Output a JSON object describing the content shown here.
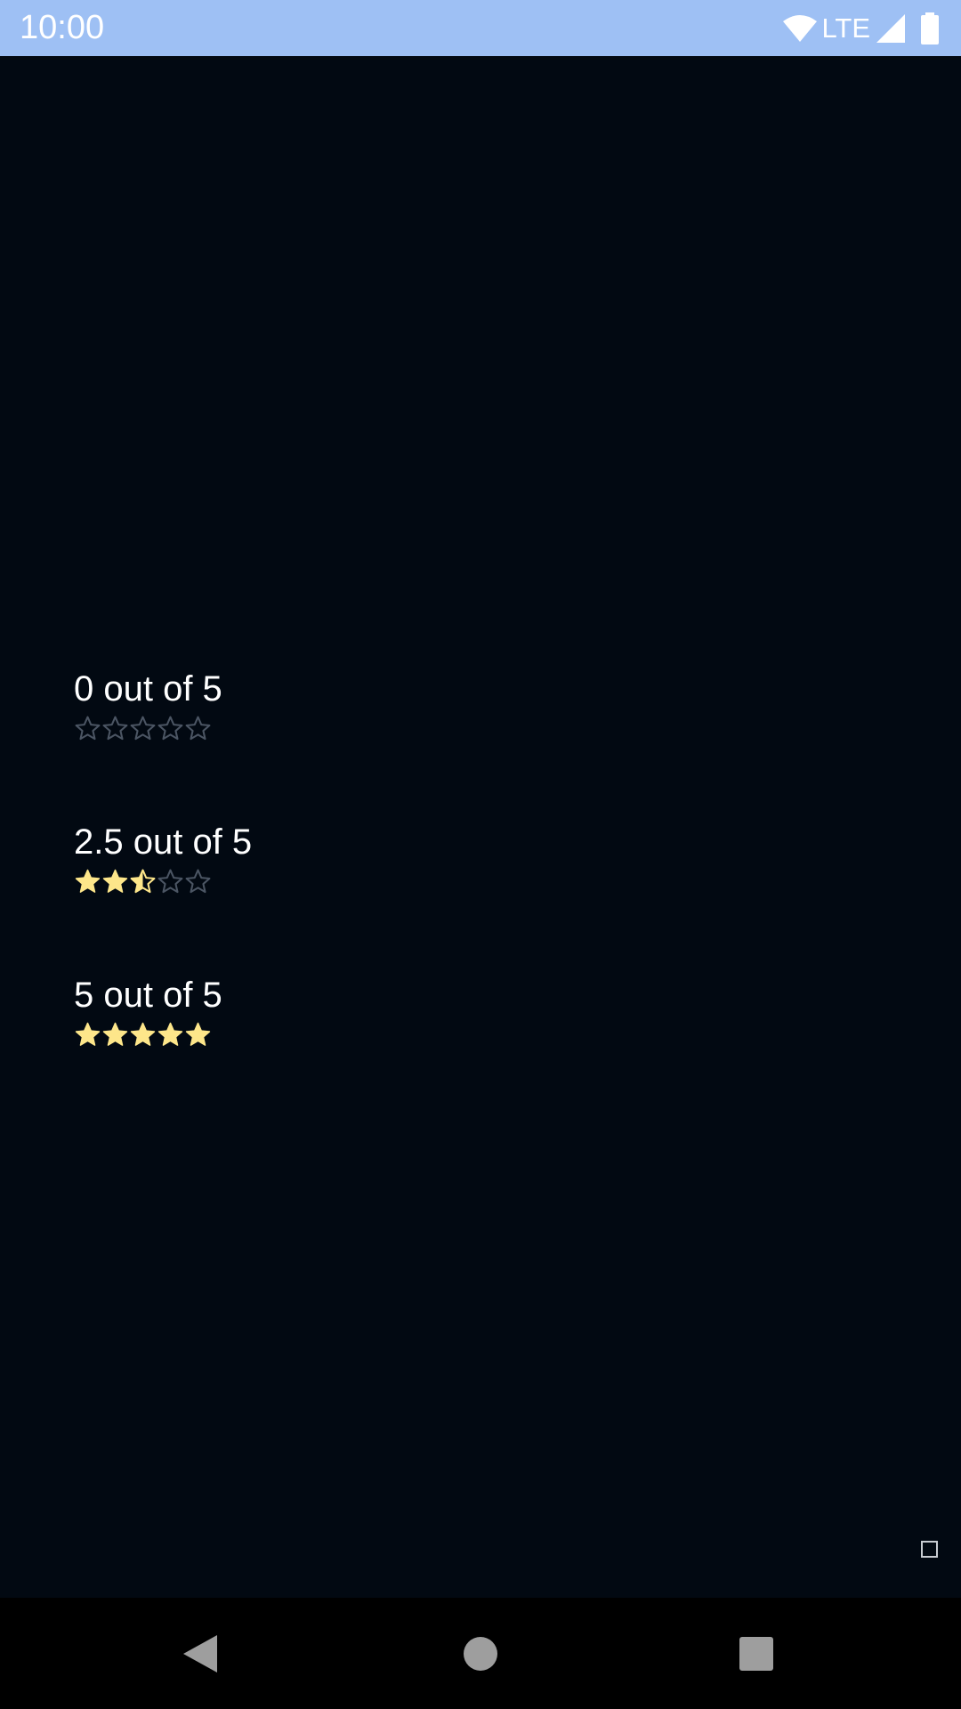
{
  "status_bar": {
    "time": "10:00",
    "network": "LTE",
    "icons": [
      "wifi-icon",
      "signal-icon",
      "battery-icon"
    ]
  },
  "ratings": [
    {
      "label": "0 out of 5",
      "value": 0,
      "max": 5
    },
    {
      "label": "2.5 out of 5",
      "value": 2.5,
      "max": 5
    },
    {
      "label": "5 out of 5",
      "value": 5,
      "max": 5
    }
  ],
  "colors": {
    "background": "#020912",
    "status_bar": "#9ec0f4",
    "star_filled": "#fde68a",
    "star_empty": "#4b5563"
  },
  "nav_bar": {
    "buttons": [
      "back-icon",
      "home-icon",
      "recents-icon"
    ]
  }
}
